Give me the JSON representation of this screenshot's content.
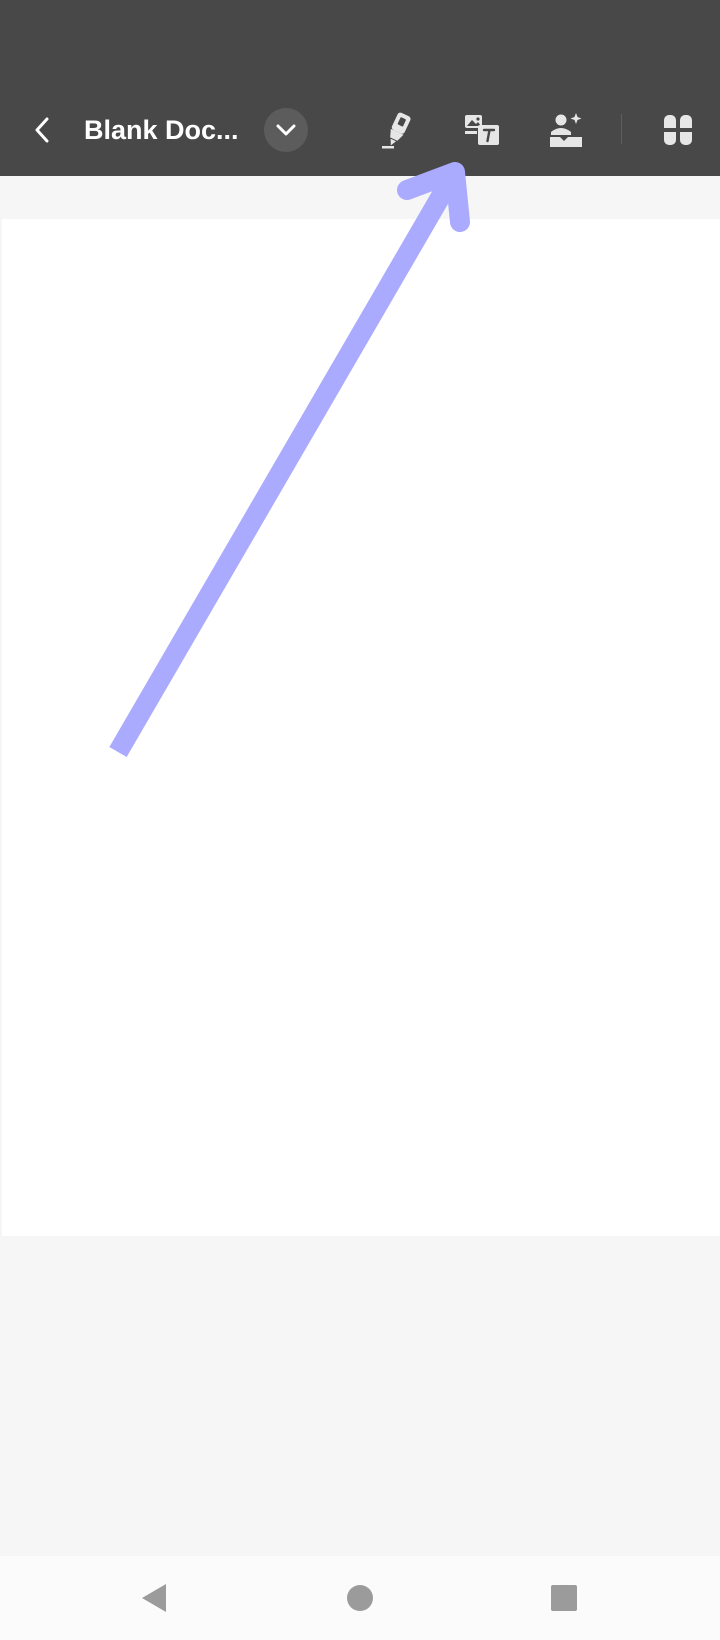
{
  "header": {
    "title": "Blank Doc...",
    "back_icon": "chevron-left-icon",
    "dropdown_icon": "chevron-down-icon",
    "tools": [
      {
        "id": "highlighter",
        "icon": "highlighter-icon"
      },
      {
        "id": "image-to-text",
        "icon": "image-text-icon"
      },
      {
        "id": "ai-image",
        "icon": "ai-image-icon"
      },
      {
        "id": "apps",
        "icon": "apps-grid-icon"
      }
    ]
  },
  "annotation": {
    "type": "arrow",
    "color": "#aaaaff",
    "points_to": "image-to-text"
  },
  "nav_bar": {
    "buttons": [
      {
        "id": "back",
        "icon": "triangle-back-icon"
      },
      {
        "id": "home",
        "icon": "circle-home-icon"
      },
      {
        "id": "recents",
        "icon": "square-recents-icon"
      }
    ]
  },
  "colors": {
    "toolbar_bg": "#484848",
    "page_bg": "#f6f6f6",
    "document_bg": "#ffffff",
    "icon": "#e6e6e6",
    "nav_icon": "#9b9b9b"
  }
}
